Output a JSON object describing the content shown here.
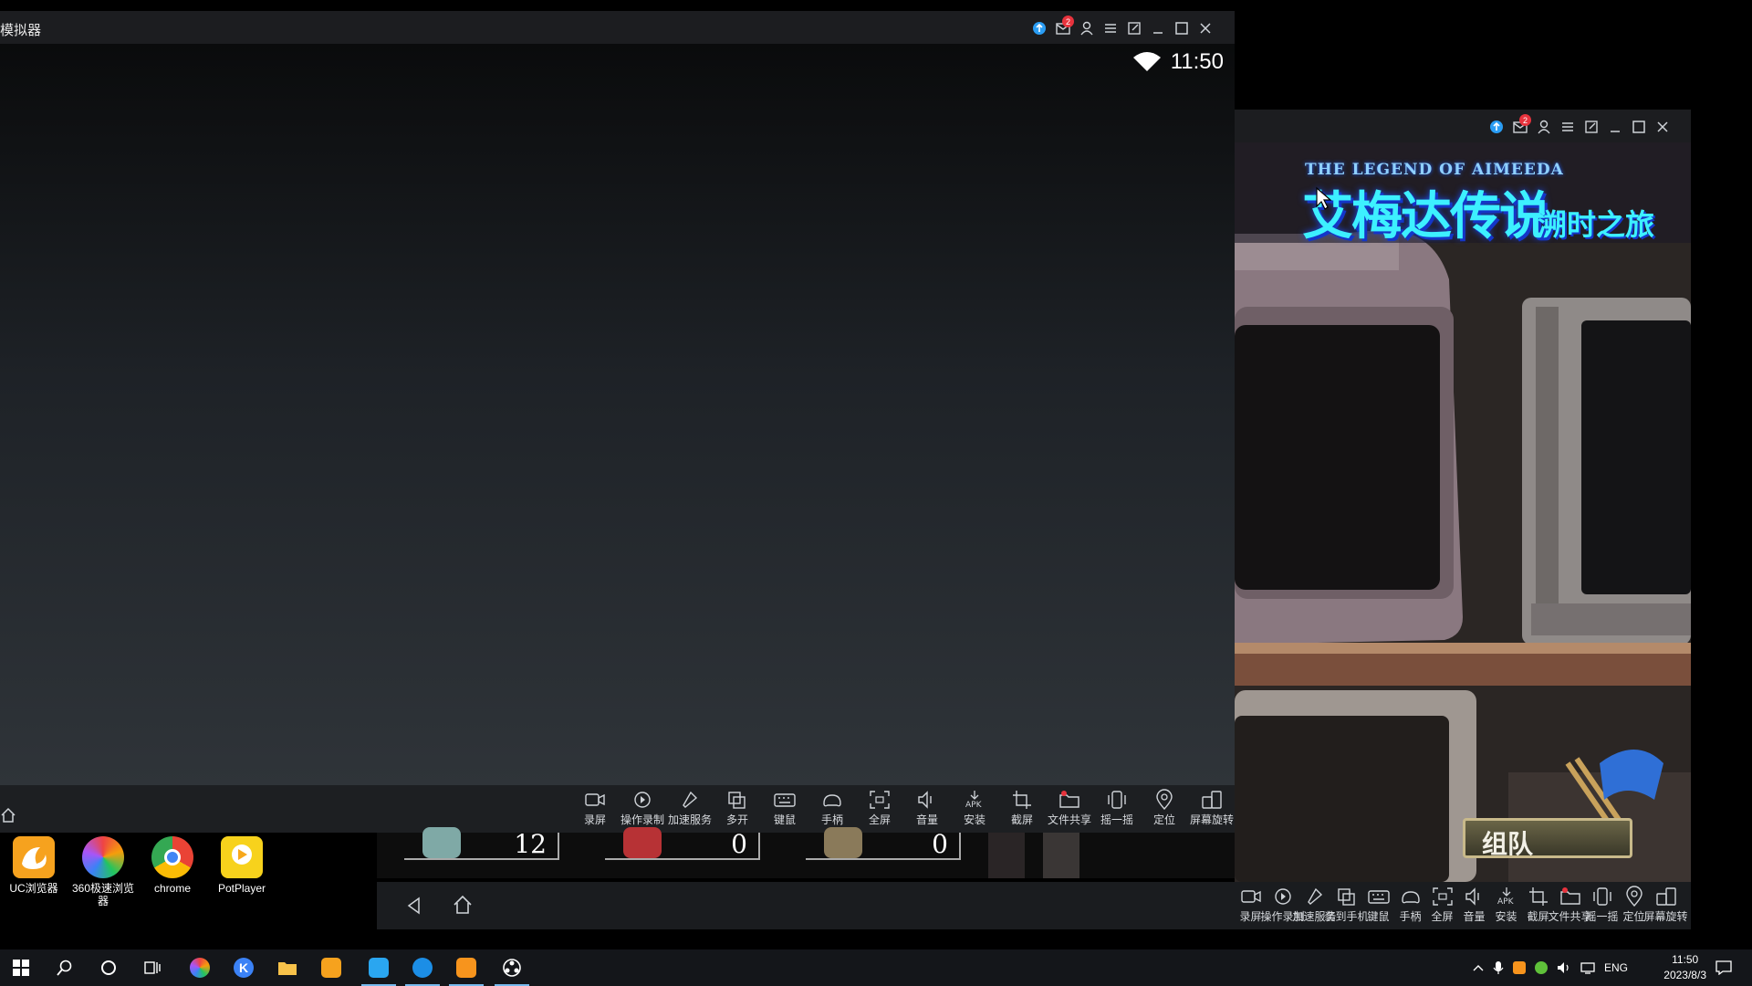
{
  "left_window": {
    "title": "模拟器",
    "notification_count": "2",
    "status_time": "11:50",
    "toolbar": [
      "录屏",
      "操作录制",
      "加速服务",
      "多开",
      "键鼠",
      "手柄",
      "全屏",
      "音量",
      "安装",
      "截屏",
      "文件共享",
      "摇一摇",
      "定位",
      "屏幕旋转"
    ]
  },
  "right_window": {
    "notification_count": "2",
    "game": {
      "logo_en": "THE LEGEND OF AIMEEDA",
      "logo_cn": "艾梅达传说",
      "logo_sub": "溯时之旅",
      "team_button": "组队"
    },
    "toolbar": [
      "录屏",
      "操作录制",
      "加速服务",
      "装到手机",
      "键鼠",
      "手柄",
      "全屏",
      "音量",
      "安装",
      "截屏",
      "文件共享",
      "摇一摇",
      "定位",
      "屏幕旋转"
    ]
  },
  "behind_window": {
    "counters": [
      "12",
      "0",
      "0"
    ]
  },
  "desktop_icons": [
    {
      "label": "UC浏览器",
      "icon": "uc-browser-icon",
      "color": "#f6a21e"
    },
    {
      "label": "360极速浏览器",
      "icon": "360-browser-icon",
      "color": "#6ad14a"
    },
    {
      "label": "chrome",
      "icon": "chrome-icon",
      "color": "#4285f4"
    },
    {
      "label": "PotPlayer",
      "icon": "potplayer-icon",
      "color": "#f7d21c"
    }
  ],
  "taskbar": {
    "language": "ENG",
    "time": "11:50",
    "date": "2023/8/3"
  },
  "colors": {
    "accent": "#76b9ed",
    "badge": "#e8333d",
    "logo": "#3df0ff"
  }
}
